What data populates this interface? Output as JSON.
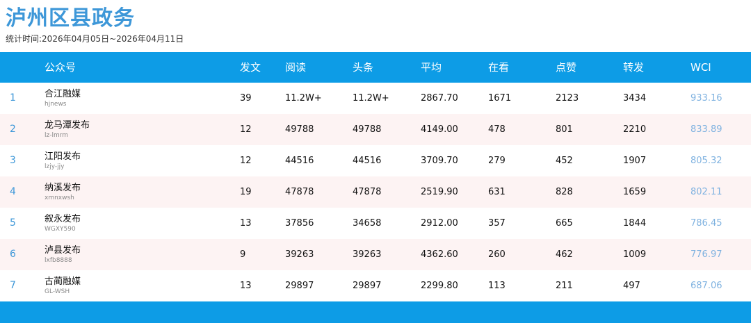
{
  "title": "泸州区县政务",
  "subtitle": "统计时间:2026年04月05日~2026年04月11日",
  "columns": {
    "account": "公众号",
    "posts": "发文",
    "reads": "阅读",
    "top": "头条",
    "avg": "平均",
    "watch": "在看",
    "like": "点赞",
    "share": "转发",
    "wci": "WCI"
  },
  "rows": [
    {
      "rank": "1",
      "name": "合江融媒",
      "id": "hjnews",
      "posts": "39",
      "reads": "11.2W+",
      "top": "11.2W+",
      "avg": "2867.70",
      "watch": "1671",
      "like": "2123",
      "share": "3434",
      "wci": "933.16"
    },
    {
      "rank": "2",
      "name": "龙马潭发布",
      "id": "lz-lmrm",
      "posts": "12",
      "reads": "49788",
      "top": "49788",
      "avg": "4149.00",
      "watch": "478",
      "like": "801",
      "share": "2210",
      "wci": "833.89"
    },
    {
      "rank": "3",
      "name": "江阳发布",
      "id": "lzjy-jjy",
      "posts": "12",
      "reads": "44516",
      "top": "44516",
      "avg": "3709.70",
      "watch": "279",
      "like": "452",
      "share": "1907",
      "wci": "805.32"
    },
    {
      "rank": "4",
      "name": "纳溪发布",
      "id": "xmnxwsh",
      "posts": "19",
      "reads": "47878",
      "top": "47878",
      "avg": "2519.90",
      "watch": "631",
      "like": "828",
      "share": "1659",
      "wci": "802.11"
    },
    {
      "rank": "5",
      "name": "叙永发布",
      "id": "WGXY590",
      "posts": "13",
      "reads": "37856",
      "top": "34658",
      "avg": "2912.00",
      "watch": "357",
      "like": "665",
      "share": "1844",
      "wci": "786.45"
    },
    {
      "rank": "6",
      "name": "泸县发布",
      "id": "lxfb8888",
      "posts": "9",
      "reads": "39263",
      "top": "39263",
      "avg": "4362.60",
      "watch": "260",
      "like": "462",
      "share": "1009",
      "wci": "776.97"
    },
    {
      "rank": "7",
      "name": "古蔺融媒",
      "id": "GL-WSH",
      "posts": "13",
      "reads": "29897",
      "top": "29897",
      "avg": "2299.80",
      "watch": "113",
      "like": "211",
      "share": "497",
      "wci": "687.06"
    }
  ],
  "colors": {
    "accent": "#0d9ce6",
    "title": "#3d97d8",
    "row_alt": "#fdf3f3",
    "wci": "#7fb2e0"
  }
}
